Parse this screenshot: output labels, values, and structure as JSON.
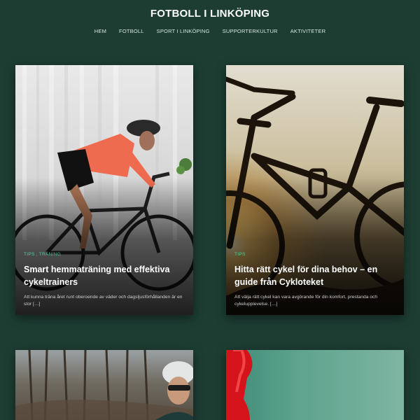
{
  "site": {
    "title": "FOTBOLL I LINKÖPING"
  },
  "nav": {
    "items": [
      {
        "label": "HEM"
      },
      {
        "label": "FOTBOLL"
      },
      {
        "label": "SPORT I LINKÖPING"
      },
      {
        "label": "SUPPORTERKULTUR"
      },
      {
        "label": "AKTIVITETER"
      }
    ]
  },
  "posts": [
    {
      "categories": [
        "TIPS",
        "TRÄNING"
      ],
      "category_separator": ",",
      "title": "Smart hemmaträning med effektiva cykeltrainers",
      "excerpt": "Att kunna träna året runt oberoende av väder och dagsljusförhållanden är en stor […]"
    },
    {
      "categories": [
        "TIPS"
      ],
      "title": "Hitta rätt cykel för dina behov – en guide från Cykloteket",
      "excerpt": "Att välja rätt cykel kan vara avgörande för din komfort, prestanda och cykelupplevelse. […]"
    },
    {
      "image": "cyclist-in-forest"
    },
    {
      "image": "red-object-green-background"
    }
  ],
  "colors": {
    "background": "#1d3d33",
    "category_accent": "#4fd1a5"
  }
}
